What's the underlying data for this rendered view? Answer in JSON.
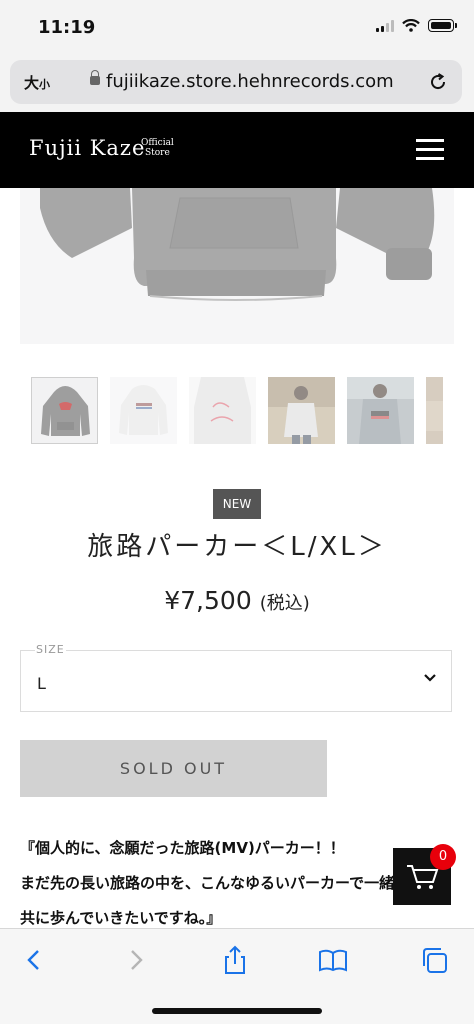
{
  "status_bar": {
    "time": "11:19"
  },
  "browser": {
    "text_size_label": "大",
    "text_size_small": "小",
    "url": "fujiikaze.store.hehnrecords.com"
  },
  "site": {
    "logo": "Fujii Kaze",
    "logo_sub_1": "Official",
    "logo_sub_2": "Store"
  },
  "product": {
    "badge": "NEW",
    "title": "旅路パーカー＜L/XL＞",
    "price": "¥7,500",
    "tax_note": "(税込)",
    "size_label": "SIZE",
    "size_value": "L",
    "button": "SOLD OUT",
    "description": [
      "『個人的に、念願だった旅路(MV)パーカー！！",
      "まだ先の長い旅路の中を、こんなゆるいパーカーで一緒に",
      "共に歩んでいきたいですね。』"
    ]
  },
  "cart": {
    "count": "0"
  },
  "thumbnails": [
    "grey-hoodie",
    "white-hoodie-back",
    "white-hoodie-print",
    "model-front",
    "model-back",
    "partial"
  ]
}
